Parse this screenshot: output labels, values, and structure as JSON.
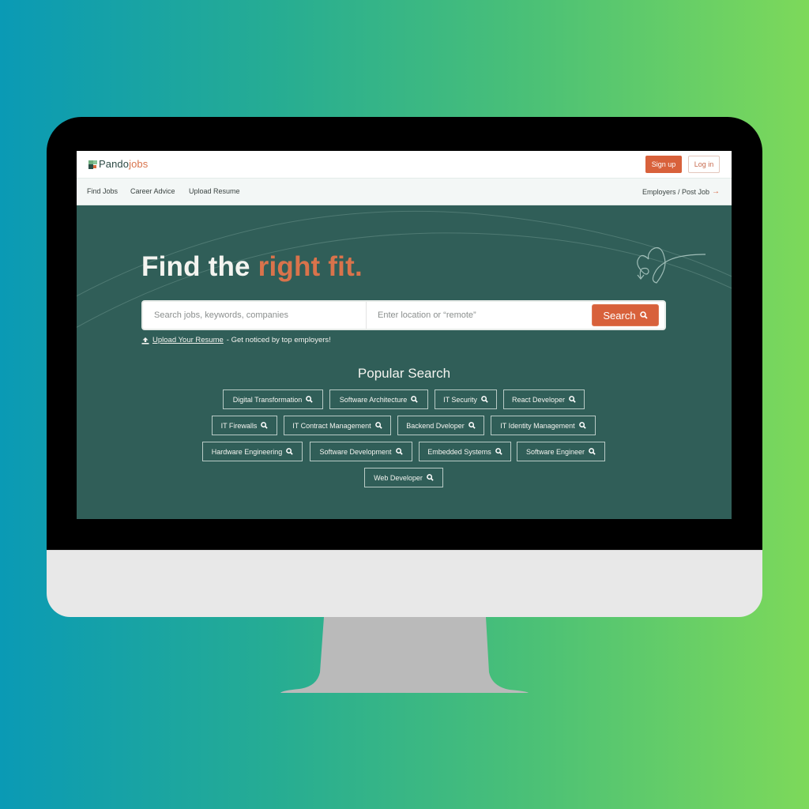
{
  "brand": {
    "logo_primary": "Pando",
    "logo_secondary": "jobs",
    "accent_color": "#d8613b",
    "hero_bg_color": "#305e58"
  },
  "header": {
    "signup_label": "Sign up",
    "login_label": "Log in"
  },
  "nav": {
    "items": [
      {
        "label": "Find Jobs"
      },
      {
        "label": "Career Advice"
      },
      {
        "label": "Upload Resume"
      }
    ],
    "employers_label": "Employers / Post Job",
    "employers_icon": "arrow-right-icon"
  },
  "hero": {
    "title_main": "Find the ",
    "title_accent": "right fit.",
    "decoration_icon": "heart-doodle-icon"
  },
  "search": {
    "jobs_placeholder": "Search jobs, keywords, companies",
    "jobs_value": "",
    "location_placeholder": "Enter location or “remote”",
    "location_value": "",
    "button_label": "Search",
    "button_icon": "search-icon"
  },
  "upload": {
    "icon": "upload-icon",
    "link_label": "Upload Your Resume",
    "tagline": " - Get noticed by top employers!"
  },
  "popular": {
    "title": "Popular Search",
    "chip_icon": "search-icon",
    "rows": [
      [
        "Digital Transformation",
        "Software Architecture",
        "IT Security",
        "React Developer"
      ],
      [
        "IT Firewalls",
        "IT Contract Management",
        "Backend Dveloper",
        "IT Identity Management"
      ],
      [
        "Hardware Engineering",
        "Software Development",
        "Embedded Systems",
        "Software Engineer"
      ],
      [
        "Web Developer"
      ]
    ]
  }
}
